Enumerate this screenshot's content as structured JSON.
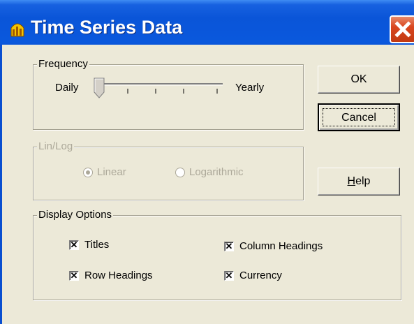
{
  "window": {
    "title": "Time Series Data",
    "icon": "chart-bars-icon",
    "close_icon": "close-icon"
  },
  "frequency": {
    "legend": "Frequency",
    "min_label": "Daily",
    "max_label": "Yearly",
    "position": 0,
    "stops": 5
  },
  "linlog": {
    "legend": "Lin/Log",
    "enabled": false,
    "options": [
      {
        "label": "Linear",
        "selected": true
      },
      {
        "label": "Logarithmic",
        "selected": false
      }
    ]
  },
  "display_options": {
    "legend": "Display Options",
    "items": [
      {
        "label": "Titles",
        "checked": true
      },
      {
        "label": "Column Headings",
        "checked": true
      },
      {
        "label": "Row Headings",
        "checked": true
      },
      {
        "label": "Currency",
        "checked": true
      }
    ]
  },
  "buttons": {
    "ok": "OK",
    "cancel": "Cancel",
    "help": "Help"
  },
  "colors": {
    "titlebar": "#0a55d8",
    "face": "#ece9d8",
    "close": "#d9461f",
    "disabled": "#aca899"
  }
}
